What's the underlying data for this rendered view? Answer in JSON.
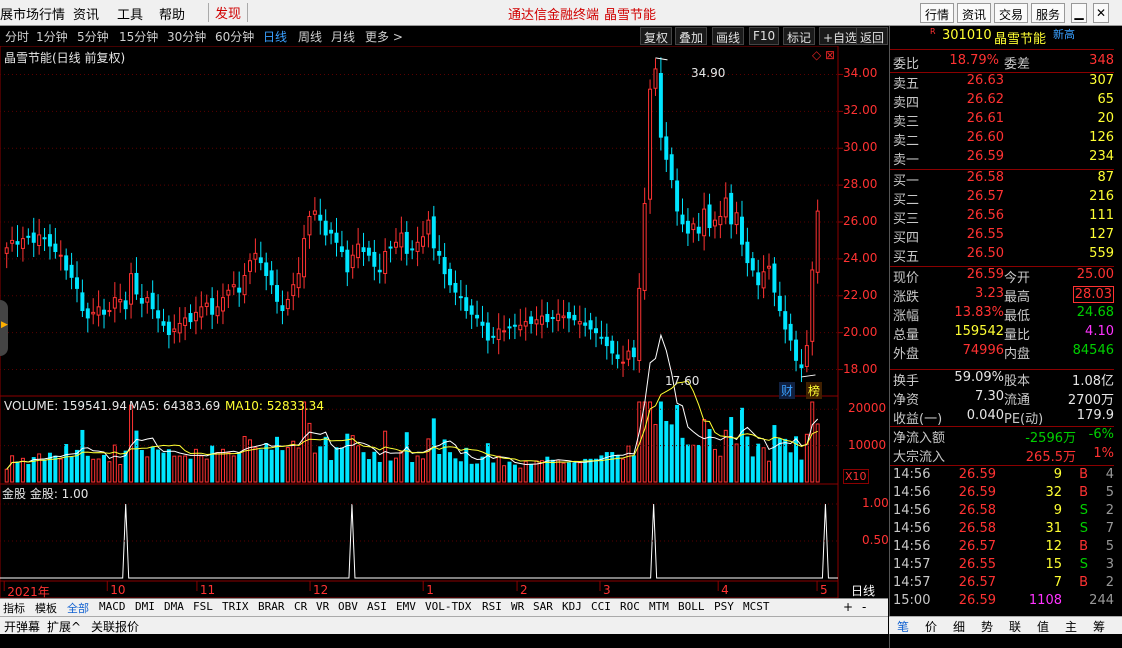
{
  "menu": {
    "items": [
      "展市场行情",
      "资讯",
      "工具",
      "帮助"
    ],
    "discover": "发现",
    "center_title": "通达信金融终端",
    "center_stock": "晶雪节能",
    "buttons": [
      "行情",
      "资讯",
      "交易",
      "服务"
    ]
  },
  "toolbar": {
    "periods": [
      "分时",
      "1分钟",
      "5分钟",
      "15分钟",
      "30分钟",
      "60分钟",
      "日线",
      "周线",
      "月线",
      "更多 >"
    ],
    "selected": "日线",
    "right_buttons": [
      "复权",
      "叠加",
      "画线",
      "F10",
      "标记",
      "+自选",
      "返回"
    ]
  },
  "chart": {
    "title": "晶雪节能(日线 前复权)",
    "high_label": "34.90",
    "low_label": "17.60",
    "price_ticks": [
      "34.00",
      "32.00",
      "30.00",
      "28.00",
      "26.00",
      "24.00",
      "22.00",
      "20.00",
      "18.00"
    ],
    "badges": [
      "财",
      "榜"
    ],
    "volume_header": {
      "label": "VOLUME: 159541.94",
      "ma5": "MA5: 64383.69",
      "ma10": "MA10: 52833.34"
    },
    "volume_ticks": [
      "20000",
      "10000"
    ],
    "volume_unit": "X10",
    "jingu_header": "金股  金股: 1.00",
    "jingu_ticks": [
      "1.00",
      "0.50"
    ],
    "date_ticks": [
      "2021年",
      "10",
      "11",
      "12",
      "1",
      "2",
      "3",
      "4",
      "5"
    ],
    "period_label": "日线"
  },
  "chart_data": {
    "type": "candlestick",
    "title": "晶雪节能(日线 前复权)",
    "ylim": [
      17,
      35
    ],
    "price_high": 34.9,
    "price_low": 17.6,
    "closes": [
      24.6,
      25.0,
      24.8,
      25.1,
      25.2,
      24.9,
      25.3,
      25.1,
      24.7,
      24.4,
      24.2,
      23.4,
      23.0,
      22.4,
      21.2,
      20.8,
      21.1,
      21.4,
      21.0,
      21.2,
      21.9,
      21.8,
      21.3,
      23.2,
      22.1,
      21.6,
      21.9,
      21.3,
      20.8,
      20.4,
      19.9,
      20.2,
      20.5,
      20.8,
      20.6,
      21.1,
      21.4,
      21.6,
      21.0,
      21.4,
      21.9,
      22.3,
      22.6,
      22.2,
      23.1,
      23.9,
      24.3,
      23.8,
      23.1,
      22.6,
      21.7,
      21.2,
      21.8,
      22.6,
      23.2,
      25.1,
      26.3,
      26.6,
      26.1,
      25.3,
      25.4,
      24.9,
      24.4,
      23.3,
      24.2,
      24.8,
      24.4,
      24.2,
      23.6,
      23.3,
      24.4,
      24.6,
      24.9,
      25.4,
      24.3,
      24.5,
      24.9,
      25.2,
      26.1,
      24.6,
      24.2,
      23.2,
      22.6,
      22.2,
      21.9,
      21.2,
      21.0,
      20.8,
      20.4,
      19.6,
      19.8,
      20.2,
      20.1,
      20.3,
      20.4,
      20.4,
      20.6,
      20.5,
      20.7,
      20.9,
      20.6,
      20.8,
      21.0,
      20.9,
      20.8,
      20.7,
      20.6,
      20.4,
      20.2,
      20.0,
      19.7,
      19.3,
      18.9,
      18.6,
      18.4,
      19.0,
      18.7,
      22.4,
      27.0,
      33.2,
      34.3,
      30.6,
      29.4,
      28.3,
      26.6,
      25.9,
      25.4,
      25.9,
      25.4,
      26.7,
      25.7,
      26.1,
      26.3,
      27.3,
      25.9,
      26.5,
      24.8,
      23.8,
      23.4,
      22.6,
      23.3,
      23.6,
      22.2,
      21.2,
      20.2,
      19.6,
      18.5,
      18.1,
      19.3,
      23.4,
      26.59
    ],
    "volume_current": 159541.94,
    "ma5": 64383.69,
    "ma10": 52833.34,
    "jingu_signal": 1.0
  },
  "quote": {
    "code": "301010",
    "name": "晶雪节能",
    "tag": "R",
    "note": "新高",
    "weibi_label": "委比",
    "weibi": "18.79%",
    "weicha_label": "委差",
    "weicha": "348",
    "asks": [
      {
        "label": "卖五",
        "price": "26.63",
        "vol": "307"
      },
      {
        "label": "卖四",
        "price": "26.62",
        "vol": "65"
      },
      {
        "label": "卖三",
        "price": "26.61",
        "vol": "20"
      },
      {
        "label": "卖二",
        "price": "26.60",
        "vol": "126"
      },
      {
        "label": "卖一",
        "price": "26.59",
        "vol": "234"
      }
    ],
    "bids": [
      {
        "label": "买一",
        "price": "26.58",
        "vol": "87"
      },
      {
        "label": "买二",
        "price": "26.57",
        "vol": "216"
      },
      {
        "label": "买三",
        "price": "26.56",
        "vol": "111"
      },
      {
        "label": "买四",
        "price": "26.55",
        "vol": "127"
      },
      {
        "label": "买五",
        "price": "26.50",
        "vol": "559"
      }
    ],
    "stats": [
      {
        "k1": "现价",
        "v1": "26.59",
        "k2": "今开",
        "v2": "25.00"
      },
      {
        "k1": "涨跌",
        "v1": "3.23",
        "k2": "最高",
        "v2": "28.03"
      },
      {
        "k1": "涨幅",
        "v1": "13.83%",
        "k2": "最低",
        "v2": "24.68"
      },
      {
        "k1": "总量",
        "v1": "159542",
        "k2": "量比",
        "v2": "4.10"
      },
      {
        "k1": "外盘",
        "v1": "74996",
        "k2": "内盘",
        "v2": "84546"
      }
    ],
    "stats2": [
      {
        "k1": "换手",
        "v1": "59.09%",
        "k2": "股本",
        "v2": "1.08亿"
      },
      {
        "k1": "净资",
        "v1": "7.30",
        "k2": "流通",
        "v2": "2700万"
      },
      {
        "k1": "收益(一)",
        "v1": "0.040",
        "k2": "PE(动)",
        "v2": "179.9"
      }
    ],
    "flow": [
      {
        "k": "净流入额",
        "v": "-2596万",
        "p": "-6%"
      },
      {
        "k": "大宗流入",
        "v": "265.5万",
        "p": "1%"
      }
    ],
    "ticks": [
      {
        "t": "14:56",
        "p": "26.59",
        "v": "9",
        "d": "B",
        "n": "4"
      },
      {
        "t": "14:56",
        "p": "26.59",
        "v": "32",
        "d": "B",
        "n": "5"
      },
      {
        "t": "14:56",
        "p": "26.58",
        "v": "9",
        "d": "S",
        "n": "2"
      },
      {
        "t": "14:56",
        "p": "26.58",
        "v": "31",
        "d": "S",
        "n": "7"
      },
      {
        "t": "14:56",
        "p": "26.57",
        "v": "12",
        "d": "B",
        "n": "5"
      },
      {
        "t": "14:57",
        "p": "26.55",
        "v": "15",
        "d": "S",
        "n": "3"
      },
      {
        "t": "14:57",
        "p": "26.57",
        "v": "7",
        "d": "B",
        "n": "2"
      },
      {
        "t": "15:00",
        "p": "26.59",
        "v": "1108",
        "d": "",
        "n": "244"
      }
    ]
  },
  "indicator_tabs": [
    "指标",
    "模板",
    "全部",
    "MACD",
    "DMI",
    "DMA",
    "FSL",
    "TRIX",
    "BRAR",
    "CR",
    "VR",
    "OBV",
    "ASI",
    "EMV",
    "VOL-TDX",
    "RSI",
    "WR",
    "SAR",
    "KDJ",
    "CCI",
    "ROC",
    "MTM",
    "BOLL",
    "PSY",
    "MCST"
  ],
  "indicator_selected": "全部",
  "bottom_tabs": [
    "开弹幕",
    "扩展^",
    "关联报价"
  ],
  "zoom_buttons": [
    "+",
    "-"
  ],
  "right_tabs": [
    "笔",
    "价",
    "细",
    "势",
    "联",
    "值",
    "主",
    "筹"
  ]
}
